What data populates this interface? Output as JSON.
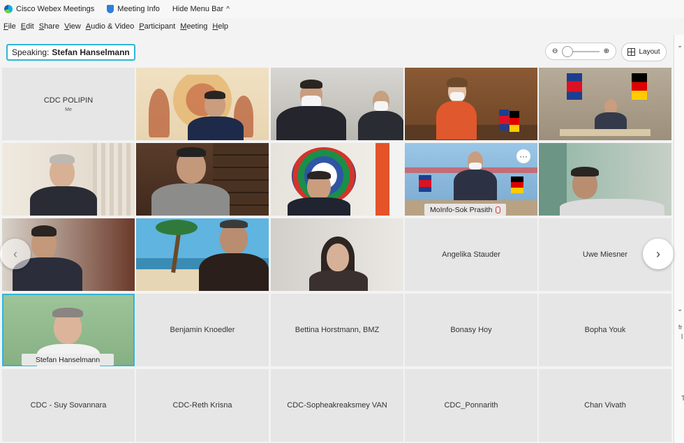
{
  "titlebar": {
    "app_name": "Cisco Webex Meetings",
    "meeting_info": "Meeting Info",
    "hide_menu": "Hide Menu Bar",
    "hide_chev": "^"
  },
  "menu": [
    "File",
    "Edit",
    "Share",
    "View",
    "Audio & Video",
    "Participant",
    "Meeting",
    "Help"
  ],
  "toolbar": {
    "speaking_label": "Speaking:",
    "speaking_name": "Stefan Hanselmann",
    "zoom_out": "⊖",
    "zoom_in": "⊕",
    "layout_label": "Layout"
  },
  "right_panel": {
    "chev_top": "⌄",
    "chev_mid": "⌄",
    "text1": "fr",
    "text2": "l",
    "text3": "T"
  },
  "nav": {
    "prev": "‹",
    "next": "›"
  },
  "tiles": {
    "t00": {
      "name": "CDC POLIPIN",
      "sub": "Me"
    },
    "t13": {
      "name": "MoInfo-Sok Prasith",
      "more": "···"
    },
    "t23": {
      "name": "Angelika Stauder"
    },
    "t24": {
      "name": "Uwe Miesner"
    },
    "t30": {
      "name": "Stefan Hanselmann"
    },
    "t31": {
      "name": "Benjamin Knoedler"
    },
    "t32": {
      "name": "Bettina Horstmann, BMZ"
    },
    "t33": {
      "name": "Bonasy Hoy"
    },
    "t34": {
      "name": "Bopha Youk"
    },
    "t40": {
      "name": "CDC - Suy Sovannara"
    },
    "t41": {
      "name": "CDC-Reth Krisna"
    },
    "t42": {
      "name": "CDC-Sopheakreaksmey VAN"
    },
    "t43": {
      "name": "CDC_Ponnarith"
    },
    "t44": {
      "name": "Chan Vivath"
    }
  },
  "colors": {
    "accent": "#2fb5d6",
    "tile_gray": "#e6e6e6"
  }
}
